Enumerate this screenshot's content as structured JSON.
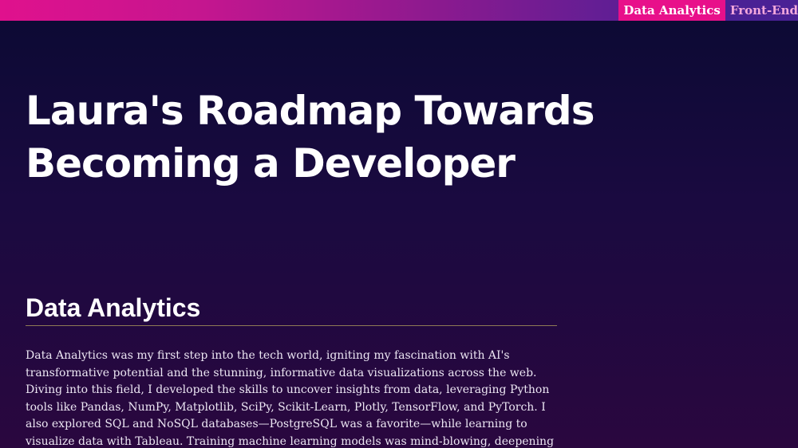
{
  "nav": {
    "items": [
      {
        "label": "Data Analytics",
        "active": true
      },
      {
        "label": "Front-End",
        "active": false
      }
    ]
  },
  "page": {
    "title": "Laura's Roadmap Towards Becoming a Developer"
  },
  "section": {
    "heading": "Data Analytics",
    "body": "Data Analytics was my first step into the tech world, igniting my fascination with AI's transformative potential and the stunning, informative data visualizations across the web. Diving into this field, I developed the skills to uncover insights from data, leveraging Python tools like Pandas, NumPy, Matplotlib, SciPy, Scikit-Learn, Plotly, TensorFlow, and PyTorch. I also explored SQL and NoSQL databases—PostgreSQL was a favorite—while learning to visualize data with Tableau. Training machine learning models was mind-blowing, deepening my appreciation for AI, which was my initial"
  },
  "colors": {
    "top_bar_start": "#e0118d",
    "top_bar_end": "#4b1f95",
    "nav_active_bg": "#e8108a",
    "nav_inactive_text": "#f3a7dc",
    "page_bg_top": "#0b0a33",
    "page_bg_bottom": "#2a073f",
    "heading_rule": "#8e7a55"
  }
}
